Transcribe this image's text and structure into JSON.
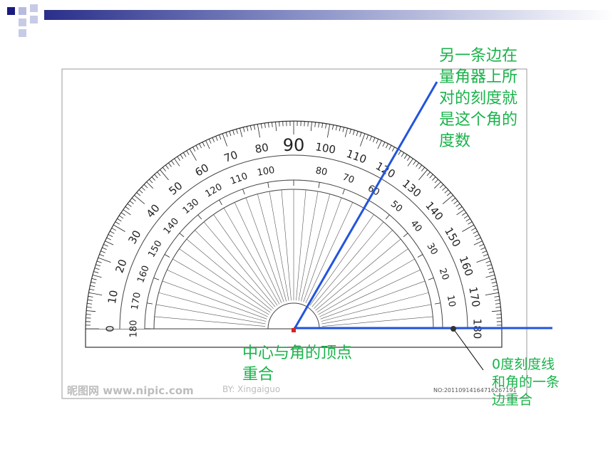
{
  "annotations": {
    "top_right": "另一条边在\n量角器上所\n对的刻度就\n是这个角的\n度数",
    "center": "中心与角的顶点\n重合",
    "bottom_right": "0度刻度线\n和角的一条\n边重合"
  },
  "protractor": {
    "outer_scale_labels": [
      "0",
      "10",
      "20",
      "30",
      "40",
      "50",
      "60",
      "70",
      "80",
      "90",
      "100",
      "110",
      "120",
      "130",
      "140",
      "150",
      "160",
      "170",
      "180"
    ],
    "inner_scale_labels": [
      "180",
      "170",
      "160",
      "150",
      "140",
      "130",
      "120",
      "110",
      "100",
      "80",
      "70",
      "60",
      "50",
      "40",
      "30",
      "20",
      "10"
    ],
    "angle_degrees": 60
  },
  "watermark": {
    "site": "昵图网 www.nipic.com",
    "by": "BY: Xingaiguo",
    "number": "NO:20110914164716267191"
  },
  "colors": {
    "annotation": "#19b34a",
    "angle_line": "#2255dd",
    "vertex": "#e02020",
    "header_square": "#1a1a80"
  }
}
